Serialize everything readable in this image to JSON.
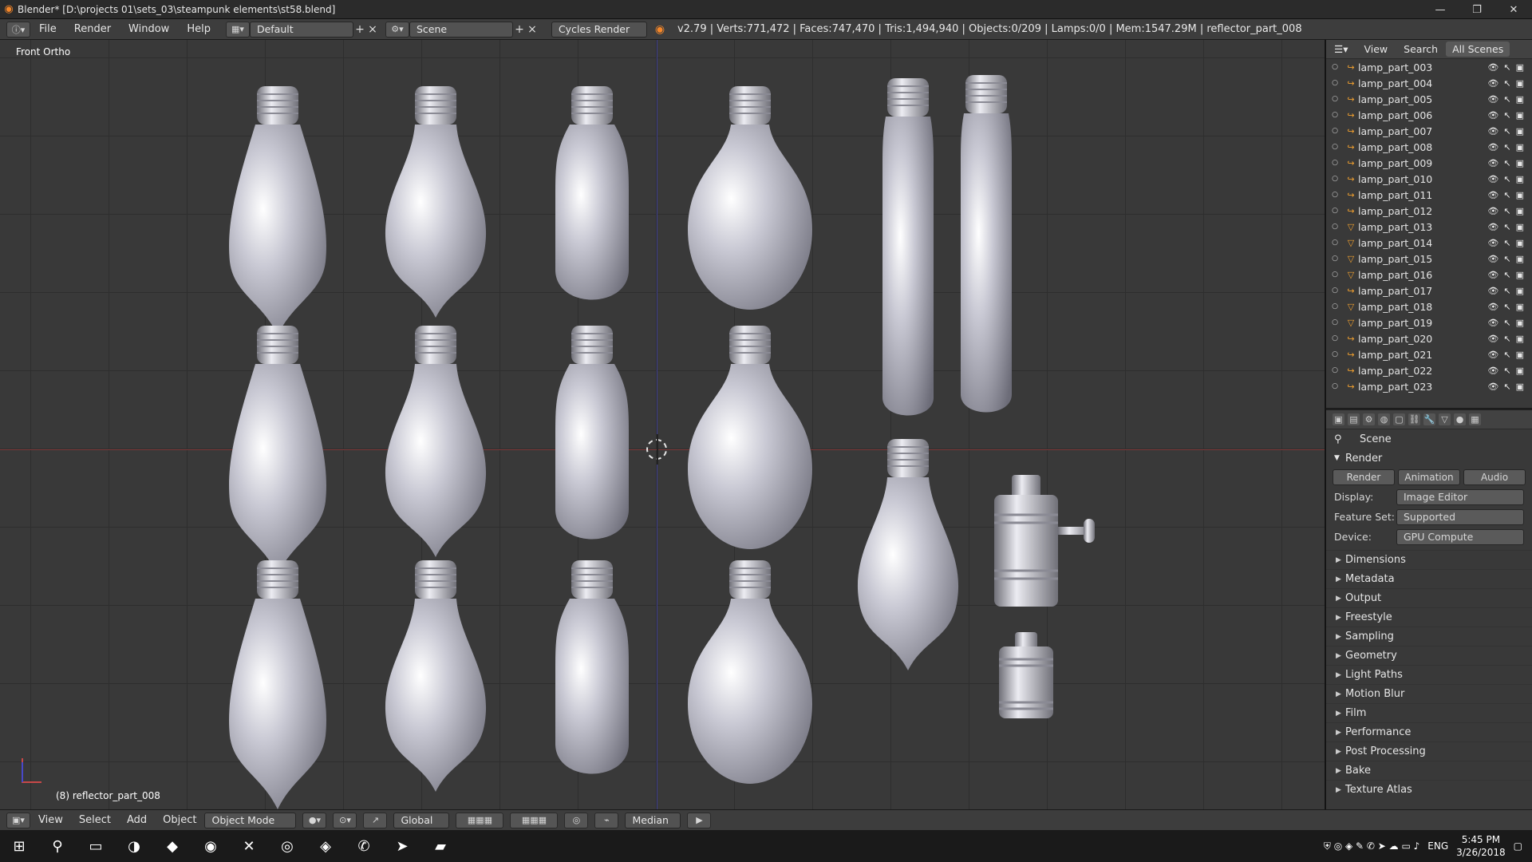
{
  "window": {
    "title": "Blender* [D:\\projects 01\\sets_03\\steampunk elements\\st58.blend]",
    "controls": [
      "—",
      "❐",
      "✕"
    ]
  },
  "infobar": {
    "menus": [
      "File",
      "Render",
      "Window",
      "Help"
    ],
    "layout": "Default",
    "scene": "Scene",
    "engine": "Cycles Render",
    "stats": "v2.79 | Verts:771,472 | Faces:747,470 | Tris:1,494,940 | Objects:0/209 | Lamps:0/0 | Mem:1547.29M | reflector_part_008"
  },
  "viewport": {
    "view_label": "Front Ortho",
    "object_label": "(8) reflector_part_008"
  },
  "outliner": {
    "header": [
      "View",
      "Search",
      "All Scenes"
    ],
    "items": [
      {
        "name": "lamp_part_003",
        "icon": "curve"
      },
      {
        "name": "lamp_part_004",
        "icon": "curve"
      },
      {
        "name": "lamp_part_005",
        "icon": "curve"
      },
      {
        "name": "lamp_part_006",
        "icon": "curve"
      },
      {
        "name": "lamp_part_007",
        "icon": "curve"
      },
      {
        "name": "lamp_part_008",
        "icon": "curve"
      },
      {
        "name": "lamp_part_009",
        "icon": "curve"
      },
      {
        "name": "lamp_part_010",
        "icon": "curve"
      },
      {
        "name": "lamp_part_011",
        "icon": "curve"
      },
      {
        "name": "lamp_part_012",
        "icon": "curve"
      },
      {
        "name": "lamp_part_013",
        "icon": "mesh"
      },
      {
        "name": "lamp_part_014",
        "icon": "mesh"
      },
      {
        "name": "lamp_part_015",
        "icon": "mesh"
      },
      {
        "name": "lamp_part_016",
        "icon": "mesh"
      },
      {
        "name": "lamp_part_017",
        "icon": "curve"
      },
      {
        "name": "lamp_part_018",
        "icon": "mesh"
      },
      {
        "name": "lamp_part_019",
        "icon": "mesh"
      },
      {
        "name": "lamp_part_020",
        "icon": "curve"
      },
      {
        "name": "lamp_part_021",
        "icon": "curve"
      },
      {
        "name": "lamp_part_022",
        "icon": "curve"
      },
      {
        "name": "lamp_part_023",
        "icon": "curve"
      }
    ]
  },
  "properties": {
    "context": "Scene",
    "section": "Render",
    "subtabs": [
      "Render",
      "Animation",
      "Audio"
    ],
    "fields": [
      {
        "label": "Display:",
        "value": "Image Editor"
      },
      {
        "label": "Feature Set:",
        "value": "Supported"
      },
      {
        "label": "Device:",
        "value": "GPU Compute"
      }
    ],
    "panels": [
      "Dimensions",
      "Metadata",
      "Output",
      "Freestyle",
      "Sampling",
      "Geometry",
      "Light Paths",
      "Motion Blur",
      "Film",
      "Performance",
      "Post Processing",
      "Bake",
      "Texture Atlas"
    ]
  },
  "toolbar": {
    "menus": [
      "View",
      "Select",
      "Add",
      "Object"
    ],
    "mode": "Object Mode",
    "orientation": "Global",
    "pivot": "Median"
  },
  "taskbar": {
    "lang": "ENG",
    "time": "5:45 PM",
    "date": "3/26/2018"
  }
}
